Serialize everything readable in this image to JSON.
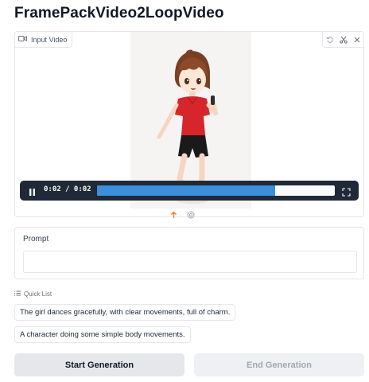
{
  "app": {
    "title": "FramePackVideo2LoopVideo"
  },
  "video": {
    "label": "Input Video",
    "label_icon": "video-icon",
    "toolbar_icons": [
      "undo-icon",
      "scissors-icon",
      "close-icon"
    ],
    "time_display": "0:02 / 0:02",
    "progress_fraction": 0.75,
    "below_icons": [
      "upload-icon",
      "webcam-icon"
    ],
    "colors": {
      "accent": "#3b8fdb",
      "controls_bg": "#1f2937",
      "upload_icon": "#f97316"
    }
  },
  "prompt": {
    "label": "Prompt",
    "value": "",
    "placeholder": ""
  },
  "quick_list": {
    "label": "Quick List",
    "label_icon": "list-icon",
    "items": [
      "The girl dances gracefully, with clear movements, full of charm.",
      "A character doing some simple body movements."
    ]
  },
  "actions": {
    "start_label": "Start Generation",
    "end_label": "End Generation"
  }
}
